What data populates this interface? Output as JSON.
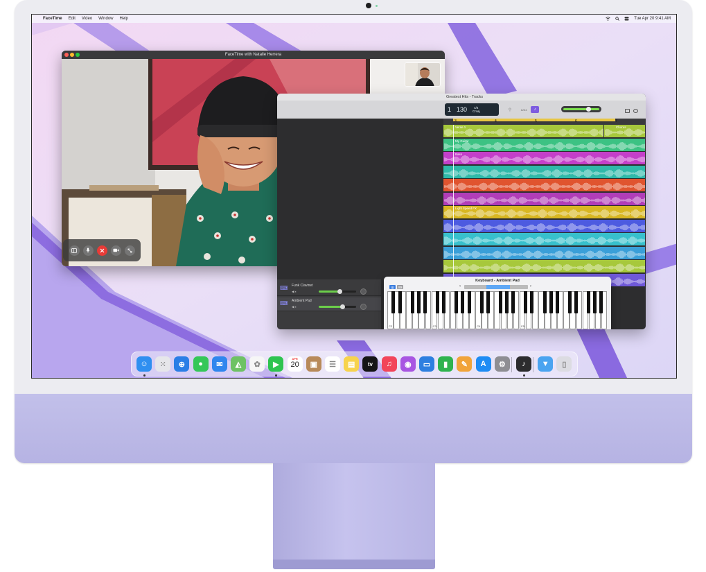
{
  "menubar": {
    "apple_symbol": "",
    "app_name": "FaceTime",
    "menus": [
      "Edit",
      "Video",
      "Window",
      "Help"
    ],
    "status_icons": [
      "wifi-icon",
      "search-icon",
      "control-center-icon"
    ],
    "datetime": "Tue Apr 20  9:41 AM"
  },
  "facetime": {
    "title": "FaceTime with Natalie Herrera",
    "controls": [
      "sidebar-icon",
      "microphone-icon",
      "end-call-icon",
      "camera-icon",
      "fullscreen-icon"
    ]
  },
  "garageband": {
    "title": "Greatest Hits - Tracks",
    "lcd": {
      "bar": "1",
      "tempo": "130",
      "time_signature": "4/4",
      "key": "Cmaj"
    },
    "ruler_marks": [
      "3",
      "4",
      "5",
      "6",
      "7"
    ],
    "regions": [
      {
        "label": "Verse 1",
        "color": "#a7c83c"
      },
      {
        "label": "Chorus",
        "color": "#a7c83c"
      },
      {
        "label": "My Guitar",
        "color": "#3cc283"
      },
      {
        "label": "Bass",
        "color": "#c43fc9"
      },
      {
        "label": "",
        "color": "#2fb9a9"
      },
      {
        "label": "",
        "color": "#e0542f"
      },
      {
        "label": "",
        "color": "#b13db8"
      },
      {
        "label": "Light Speed FX",
        "color": "#d8b722"
      },
      {
        "label": "",
        "color": "#4d5be0"
      },
      {
        "label": "",
        "color": "#38c0cc"
      },
      {
        "label": "",
        "color": "#3a9fd8"
      },
      {
        "label": "",
        "color": "#a7c83c"
      },
      {
        "label": "",
        "color": "#6f59d8"
      }
    ],
    "strips": [
      {
        "name": "Funk Clavinet"
      },
      {
        "name": "Ambient Pad"
      }
    ]
  },
  "keyboard": {
    "title": "Keyboard - Ambient Pad",
    "octave_labels": [
      "C2",
      "C3",
      "C4",
      "C5"
    ]
  },
  "dock": {
    "apps": [
      {
        "name": "finder-icon",
        "color": "#2f8ff0",
        "running": true
      },
      {
        "name": "launchpad-icon",
        "color": "#e6e6ea",
        "running": false
      },
      {
        "name": "safari-icon",
        "color": "#2b7ee6",
        "running": false
      },
      {
        "name": "messages-icon",
        "color": "#34c759",
        "running": false
      },
      {
        "name": "mail-icon",
        "color": "#2f86ee",
        "running": false
      },
      {
        "name": "maps-icon",
        "color": "#6ec265",
        "running": false
      },
      {
        "name": "photos-icon",
        "color": "#f6f6f6",
        "running": false
      },
      {
        "name": "facetime-icon",
        "color": "#2ec450",
        "running": true
      },
      {
        "name": "calendar-icon",
        "color": "#ffffff",
        "running": false
      },
      {
        "name": "contacts-icon",
        "color": "#b88a5a",
        "running": false
      },
      {
        "name": "reminders-icon",
        "color": "#ffffff",
        "running": false
      },
      {
        "name": "notes-icon",
        "color": "#f7d34d",
        "running": false
      },
      {
        "name": "tv-icon",
        "color": "#151515",
        "running": false
      },
      {
        "name": "music-icon",
        "color": "#f2455a",
        "running": false
      },
      {
        "name": "podcasts-icon",
        "color": "#a855e2",
        "running": false
      },
      {
        "name": "keynote-icon",
        "color": "#2e7fe0",
        "running": false
      },
      {
        "name": "numbers-icon",
        "color": "#2fb34f",
        "running": false
      },
      {
        "name": "pages-icon",
        "color": "#f1a43a",
        "running": false
      },
      {
        "name": "app-store-icon",
        "color": "#1e8cf4",
        "running": false
      },
      {
        "name": "system-preferences-icon",
        "color": "#8e8e93",
        "running": false
      },
      {
        "name": "garageband-icon",
        "color": "#2c2c2e",
        "running": true
      },
      {
        "name": "downloads-folder-icon",
        "color": "#4aa4f0",
        "running": false
      },
      {
        "name": "trash-icon",
        "color": "#dcdce2",
        "running": false
      }
    ],
    "calendar": {
      "month": "APR",
      "day": "20"
    },
    "tv_label": "tv"
  }
}
